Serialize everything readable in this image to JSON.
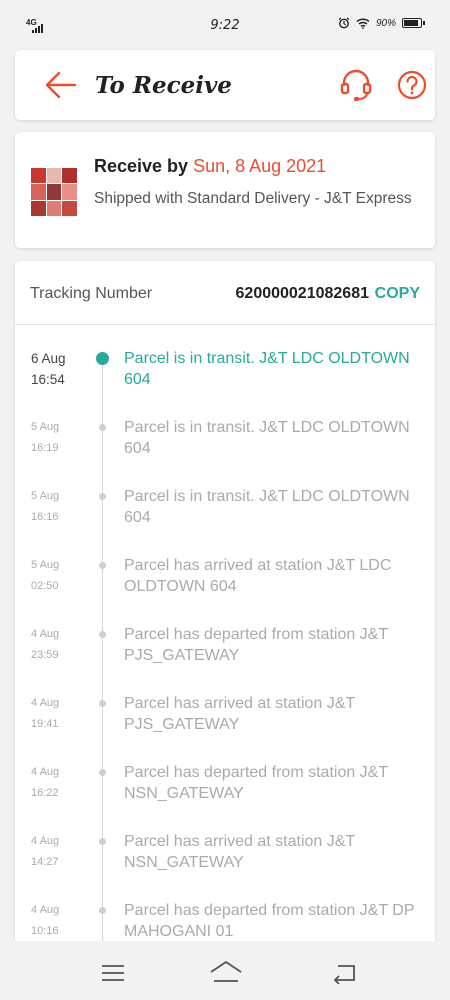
{
  "status_bar": {
    "network": "4G",
    "time": "9:22",
    "battery": "90%",
    "battery_level": 0.9
  },
  "header": {
    "title": "To Receive",
    "back_icon": "arrow-left-icon",
    "support_icon": "headset-icon",
    "help_icon": "question-circle-icon",
    "accent": "#ee4d2d"
  },
  "delivery": {
    "receive_label": "Receive by",
    "receive_date": "Sun, 8 Aug 2021",
    "shipped_text": "Shipped with Standard Delivery  - J&T Express"
  },
  "tracking": {
    "label": "Tracking Number",
    "number": "620000021082681",
    "copy_label": "COPY",
    "accent": "#26aa99",
    "events": [
      {
        "date": "6 Aug",
        "time": "16:54",
        "text": "Parcel is in transit. J&T LDC OLDTOWN 604",
        "current": true
      },
      {
        "date": "5 Aug",
        "time": "16:19",
        "text": "Parcel is in transit. J&T LDC OLDTOWN 604",
        "current": false
      },
      {
        "date": "5 Aug",
        "time": "16:16",
        "text": "Parcel is in transit. J&T LDC OLDTOWN 604",
        "current": false
      },
      {
        "date": "5 Aug",
        "time": "02:50",
        "text": "Parcel has arrived at station J&T LDC OLDTOWN 604",
        "current": false
      },
      {
        "date": "4 Aug",
        "time": "23:59",
        "text": "Parcel has departed from station J&T PJS_GATEWAY",
        "current": false
      },
      {
        "date": "4 Aug",
        "time": "19:41",
        "text": "Parcel has arrived at station J&T PJS_GATEWAY",
        "current": false
      },
      {
        "date": "4 Aug",
        "time": "16:22",
        "text": "Parcel has departed from station J&T NSN_GATEWAY",
        "current": false
      },
      {
        "date": "4 Aug",
        "time": "14:27",
        "text": "Parcel has arrived at station J&T NSN_GATEWAY",
        "current": false
      },
      {
        "date": "4 Aug",
        "time": "10:16",
        "text": "Parcel has departed from station J&T DP MAHOGANI 01",
        "current": false
      }
    ]
  },
  "nav_bar": {
    "menu_icon": "menu-icon",
    "home_icon": "home-icon",
    "back_icon": "back-icon"
  }
}
